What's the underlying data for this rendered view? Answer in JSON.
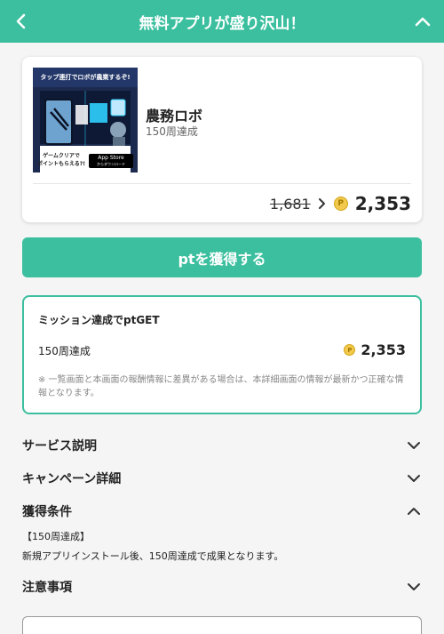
{
  "header": {
    "title": "無料アプリが盛り沢山！"
  },
  "offer": {
    "banner": {
      "caption_top": "タップ連打でロボが農業するぞ!",
      "caption_bottom_1": "ゲームクリアで",
      "caption_bottom_2": "ポイントもらえる?!",
      "store_badge_top": "App Store",
      "store_badge_bottom": "からダウンロード"
    },
    "app_name": "農務ロボ",
    "condition_short": "150周達成",
    "old_points": "1,681",
    "new_points": "2,353",
    "coin_symbol": "P"
  },
  "get_button": {
    "label": "ptを獲得する"
  },
  "mission": {
    "title": "ミッション達成でptGET",
    "row_label": "150周達成",
    "row_points": "2,353",
    "note": "※ 一覧画面と本画面の報酬情報に差異がある場合は、本詳細画面の情報が最新かつ正確な情報となります。"
  },
  "sections": {
    "service": "サービス説明",
    "campaign": "キャンペーン詳細",
    "conditions": "獲得条件",
    "conditions_tag": "【150周達成】",
    "conditions_text": "新規アプリインストール後、150周達成で成果となります。",
    "notes": "注意事項"
  },
  "colors": {
    "accent": "#3bbf9e",
    "coin": "#f2c94c"
  }
}
